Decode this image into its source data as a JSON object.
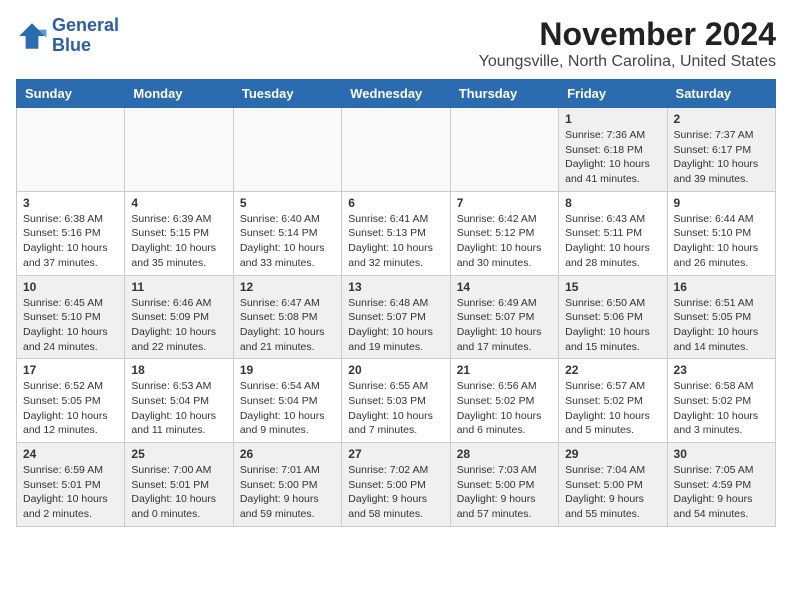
{
  "logo": {
    "line1": "General",
    "line2": "Blue"
  },
  "title": "November 2024",
  "subtitle": "Youngsville, North Carolina, United States",
  "weekdays": [
    "Sunday",
    "Monday",
    "Tuesday",
    "Wednesday",
    "Thursday",
    "Friday",
    "Saturday"
  ],
  "weeks": [
    [
      {
        "day": "",
        "info": ""
      },
      {
        "day": "",
        "info": ""
      },
      {
        "day": "",
        "info": ""
      },
      {
        "day": "",
        "info": ""
      },
      {
        "day": "",
        "info": ""
      },
      {
        "day": "1",
        "info": "Sunrise: 7:36 AM\nSunset: 6:18 PM\nDaylight: 10 hours\nand 41 minutes."
      },
      {
        "day": "2",
        "info": "Sunrise: 7:37 AM\nSunset: 6:17 PM\nDaylight: 10 hours\nand 39 minutes."
      }
    ],
    [
      {
        "day": "3",
        "info": "Sunrise: 6:38 AM\nSunset: 5:16 PM\nDaylight: 10 hours\nand 37 minutes."
      },
      {
        "day": "4",
        "info": "Sunrise: 6:39 AM\nSunset: 5:15 PM\nDaylight: 10 hours\nand 35 minutes."
      },
      {
        "day": "5",
        "info": "Sunrise: 6:40 AM\nSunset: 5:14 PM\nDaylight: 10 hours\nand 33 minutes."
      },
      {
        "day": "6",
        "info": "Sunrise: 6:41 AM\nSunset: 5:13 PM\nDaylight: 10 hours\nand 32 minutes."
      },
      {
        "day": "7",
        "info": "Sunrise: 6:42 AM\nSunset: 5:12 PM\nDaylight: 10 hours\nand 30 minutes."
      },
      {
        "day": "8",
        "info": "Sunrise: 6:43 AM\nSunset: 5:11 PM\nDaylight: 10 hours\nand 28 minutes."
      },
      {
        "day": "9",
        "info": "Sunrise: 6:44 AM\nSunset: 5:10 PM\nDaylight: 10 hours\nand 26 minutes."
      }
    ],
    [
      {
        "day": "10",
        "info": "Sunrise: 6:45 AM\nSunset: 5:10 PM\nDaylight: 10 hours\nand 24 minutes."
      },
      {
        "day": "11",
        "info": "Sunrise: 6:46 AM\nSunset: 5:09 PM\nDaylight: 10 hours\nand 22 minutes."
      },
      {
        "day": "12",
        "info": "Sunrise: 6:47 AM\nSunset: 5:08 PM\nDaylight: 10 hours\nand 21 minutes."
      },
      {
        "day": "13",
        "info": "Sunrise: 6:48 AM\nSunset: 5:07 PM\nDaylight: 10 hours\nand 19 minutes."
      },
      {
        "day": "14",
        "info": "Sunrise: 6:49 AM\nSunset: 5:07 PM\nDaylight: 10 hours\nand 17 minutes."
      },
      {
        "day": "15",
        "info": "Sunrise: 6:50 AM\nSunset: 5:06 PM\nDaylight: 10 hours\nand 15 minutes."
      },
      {
        "day": "16",
        "info": "Sunrise: 6:51 AM\nSunset: 5:05 PM\nDaylight: 10 hours\nand 14 minutes."
      }
    ],
    [
      {
        "day": "17",
        "info": "Sunrise: 6:52 AM\nSunset: 5:05 PM\nDaylight: 10 hours\nand 12 minutes."
      },
      {
        "day": "18",
        "info": "Sunrise: 6:53 AM\nSunset: 5:04 PM\nDaylight: 10 hours\nand 11 minutes."
      },
      {
        "day": "19",
        "info": "Sunrise: 6:54 AM\nSunset: 5:04 PM\nDaylight: 10 hours\nand 9 minutes."
      },
      {
        "day": "20",
        "info": "Sunrise: 6:55 AM\nSunset: 5:03 PM\nDaylight: 10 hours\nand 7 minutes."
      },
      {
        "day": "21",
        "info": "Sunrise: 6:56 AM\nSunset: 5:02 PM\nDaylight: 10 hours\nand 6 minutes."
      },
      {
        "day": "22",
        "info": "Sunrise: 6:57 AM\nSunset: 5:02 PM\nDaylight: 10 hours\nand 5 minutes."
      },
      {
        "day": "23",
        "info": "Sunrise: 6:58 AM\nSunset: 5:02 PM\nDaylight: 10 hours\nand 3 minutes."
      }
    ],
    [
      {
        "day": "24",
        "info": "Sunrise: 6:59 AM\nSunset: 5:01 PM\nDaylight: 10 hours\nand 2 minutes."
      },
      {
        "day": "25",
        "info": "Sunrise: 7:00 AM\nSunset: 5:01 PM\nDaylight: 10 hours\nand 0 minutes."
      },
      {
        "day": "26",
        "info": "Sunrise: 7:01 AM\nSunset: 5:00 PM\nDaylight: 9 hours\nand 59 minutes."
      },
      {
        "day": "27",
        "info": "Sunrise: 7:02 AM\nSunset: 5:00 PM\nDaylight: 9 hours\nand 58 minutes."
      },
      {
        "day": "28",
        "info": "Sunrise: 7:03 AM\nSunset: 5:00 PM\nDaylight: 9 hours\nand 57 minutes."
      },
      {
        "day": "29",
        "info": "Sunrise: 7:04 AM\nSunset: 5:00 PM\nDaylight: 9 hours\nand 55 minutes."
      },
      {
        "day": "30",
        "info": "Sunrise: 7:05 AM\nSunset: 4:59 PM\nDaylight: 9 hours\nand 54 minutes."
      }
    ]
  ]
}
